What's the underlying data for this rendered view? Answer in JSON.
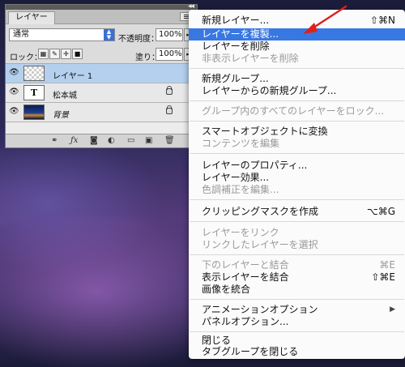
{
  "panel": {
    "tab_label": "レイヤー",
    "blend_mode": "通常",
    "opacity_label": "不透明度：",
    "opacity_value": "100%",
    "lock_label": "ロック：",
    "fill_label": "塗り：",
    "fill_value": "100%",
    "layers": [
      {
        "name": "レイヤー 1",
        "thumb": "transparent",
        "selected": true
      },
      {
        "name": "松本城",
        "thumb_text": "T"
      },
      {
        "name": "背景",
        "thumb": "photo"
      }
    ],
    "footer_icons": [
      "link-icon",
      "fx-icon",
      "mask-icon",
      "adjustment-icon",
      "folder-icon",
      "new-layer-icon",
      "trash-icon"
    ]
  },
  "menu": {
    "items": [
      {
        "label": "新規レイヤー...",
        "shortcut": "⇧⌘N"
      },
      {
        "label": "レイヤーを複製...",
        "highlighted": true
      },
      {
        "label": "レイヤーを削除"
      },
      {
        "label": "非表示レイヤーを削除",
        "disabled": true
      },
      {
        "label": "新規グループ..."
      },
      {
        "label": "レイヤーからの新規グループ..."
      },
      {
        "label": "グループ内のすべてのレイヤーをロック...",
        "disabled": true
      },
      {
        "label": "スマートオブジェクトに変換"
      },
      {
        "label": "コンテンツを編集",
        "disabled": true
      },
      {
        "label": "レイヤーのプロパティ..."
      },
      {
        "label": "レイヤー効果..."
      },
      {
        "label": "色調補正を編集...",
        "disabled": true
      },
      {
        "label": "クリッピングマスクを作成",
        "shortcut": "⌥⌘G"
      },
      {
        "label": "レイヤーをリンク",
        "disabled": true
      },
      {
        "label": "リンクしたレイヤーを選択",
        "disabled": true
      },
      {
        "label": "下のレイヤーと結合",
        "shortcut": "⌘E",
        "disabled": true
      },
      {
        "label": "表示レイヤーを結合",
        "shortcut": "⇧⌘E"
      },
      {
        "label": "画像を統合"
      },
      {
        "label": "アニメーションオプション",
        "submenu": true
      },
      {
        "label": "パネルオプション..."
      },
      {
        "label": "閉じる"
      },
      {
        "label": "タブグループを閉じる"
      }
    ]
  },
  "colors": {
    "highlight": "#3878e3",
    "annotation_arrow": "#e0201c",
    "selected_layer": "#b4d0ee"
  }
}
